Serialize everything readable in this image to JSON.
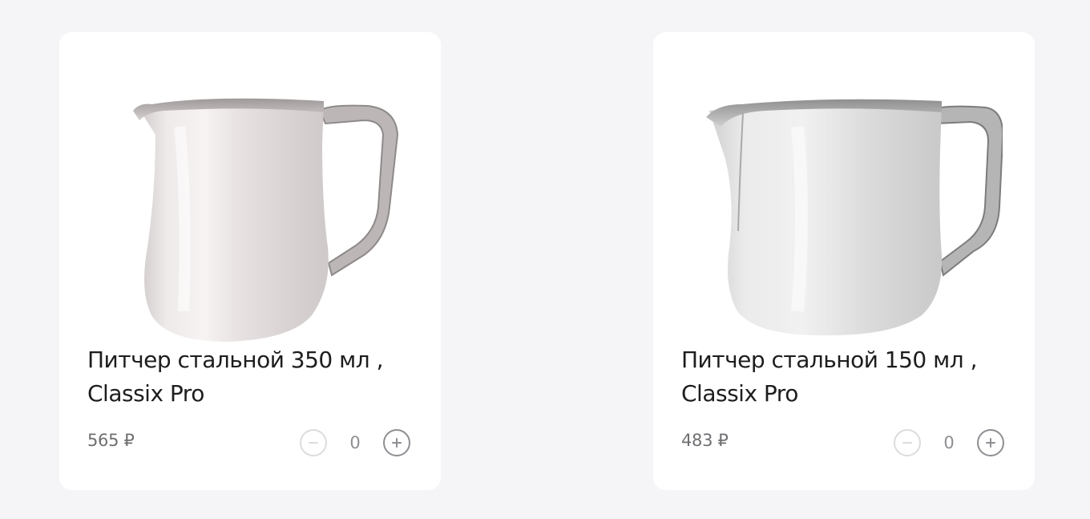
{
  "products": [
    {
      "name": "Питчер стальной 350 мл , Classix Pro",
      "price": "565 ₽",
      "quantity": "0",
      "image_icon": "milk-pitcher-image"
    },
    {
      "name": "Питчер стальной 150 мл , Classix Pro",
      "price": "483 ₽",
      "quantity": "0",
      "image_icon": "milk-pitcher-image"
    }
  ],
  "colors": {
    "background": "#f5f5f7",
    "card": "#ffffff",
    "title": "#1d1d1f",
    "price": "#6f6f73",
    "minus_border": "#dcdce0",
    "plus_border": "#8e8e93"
  }
}
